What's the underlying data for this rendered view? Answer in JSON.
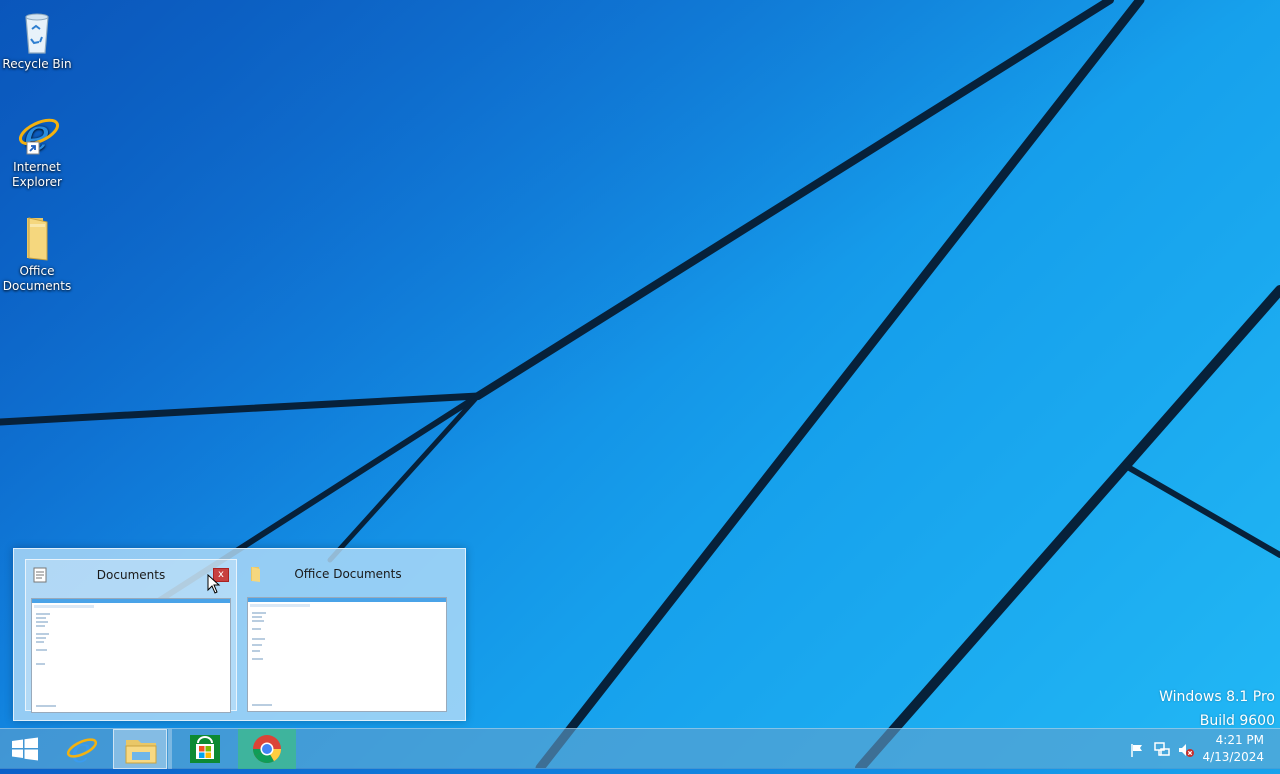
{
  "desktop": {
    "icons": [
      {
        "label_line1": "Recycle Bin",
        "label_line2": "",
        "icon": "recycle-bin-icon"
      },
      {
        "label_line1": "Internet",
        "label_line2": "Explorer",
        "icon": "internet-explorer-icon"
      },
      {
        "label_line1": "Office",
        "label_line2": "Documents",
        "icon": "folder-icon"
      }
    ]
  },
  "thumbnails": [
    {
      "title": "Documents",
      "icon": "documents-icon",
      "close_glyph": "x"
    },
    {
      "title": "Office Documents",
      "icon": "folder-icon"
    }
  ],
  "taskbar": {
    "start_icon": "windows-logo-icon",
    "apps": [
      {
        "name": "Internet Explorer",
        "icon": "internet-explorer-icon"
      },
      {
        "name": "File Explorer",
        "icon": "file-explorer-icon"
      },
      {
        "name": "Store",
        "icon": "store-icon"
      },
      {
        "name": "Google Chrome",
        "icon": "chrome-icon"
      }
    ],
    "tray_icons": [
      "action-center-flag-icon",
      "network-icon",
      "volume-muted-icon"
    ],
    "time": "4:21 PM",
    "date": "4/13/2024"
  },
  "watermark": {
    "line1": "Windows 8.1 Pro",
    "line2": "Build 9600"
  },
  "colors": {
    "wallpaper_dark": "#0a5fc8",
    "wallpaper_light": "#22b8f5",
    "close_red": "#c74040"
  }
}
